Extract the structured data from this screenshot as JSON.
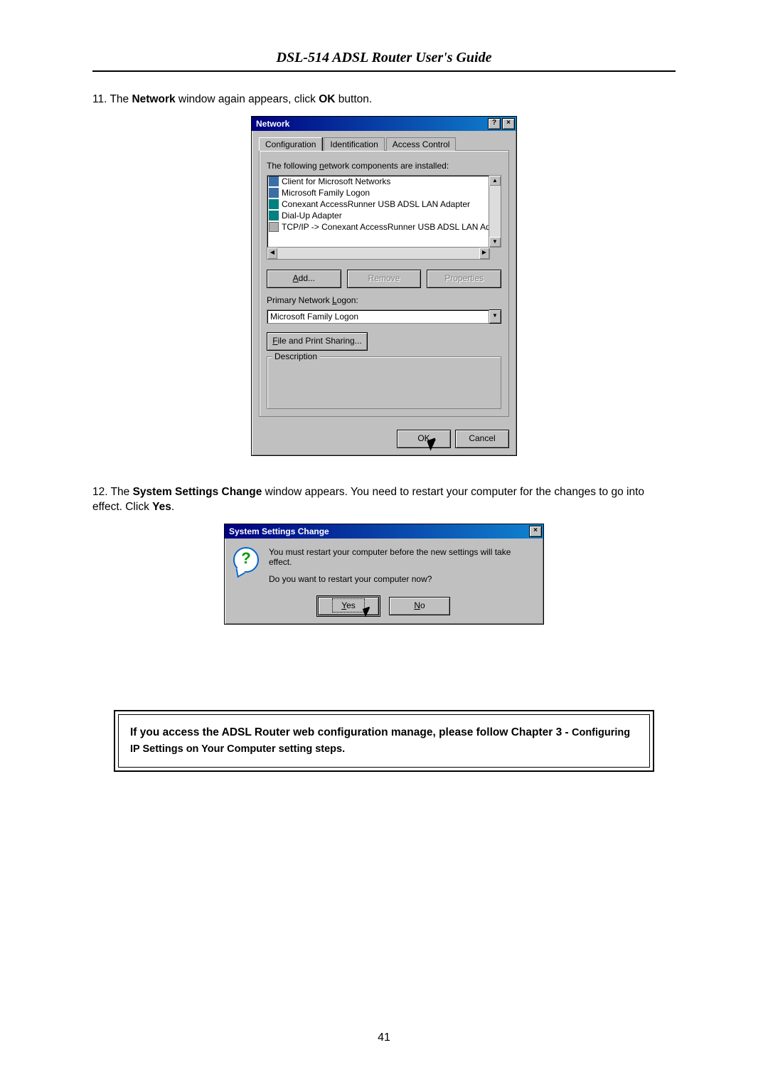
{
  "header": {
    "title": "DSL-514 ADSL Router User's Guide"
  },
  "step11": {
    "num": "11. ",
    "t1": "The ",
    "b1": "Network",
    "t2": " window again appears, click ",
    "b2": "OK",
    "t3": " button."
  },
  "network_dialog": {
    "title": "Network",
    "help_btn": "?",
    "close_btn": "×",
    "tabs": {
      "t1": "Configuration",
      "t2": "Identification",
      "t3": "Access Control"
    },
    "installed_label_pre": "The following ",
    "installed_label_u": "n",
    "installed_label_post": "etwork components are installed:",
    "components": {
      "c0": "Client for Microsoft Networks",
      "c1": "Microsoft Family Logon",
      "c2": "Conexant AccessRunner USB ADSL LAN Adapter",
      "c3": "Dial-Up Adapter",
      "c4": "TCP/IP -> Conexant AccessRunner USB ADSL LAN Ada"
    },
    "scroll": {
      "up": "▲",
      "down": "▼",
      "left": "◀",
      "right": "▶"
    },
    "buttons": {
      "add_pre": "",
      "add_u": "A",
      "add_post": "dd...",
      "remove": "Remove",
      "properties": "Properties"
    },
    "primary_logon_label_pre": "Primary Network ",
    "primary_logon_label_u": "L",
    "primary_logon_label_post": "ogon:",
    "primary_logon_value": "Microsoft Family Logon",
    "combo_arrow": "▼",
    "file_print_pre": "",
    "file_print_u": "F",
    "file_print_post": "ile and Print Sharing...",
    "description_label": "Description",
    "ok": "OK",
    "cancel": "Cancel"
  },
  "step12": {
    "num": "12. ",
    "t1": "The ",
    "b1": "System Settings Change",
    "t2": " window appears. You need to restart your computer for the changes to go into effect. Click ",
    "b2": "Yes",
    "t3": "."
  },
  "ssc_dialog": {
    "title": "System Settings Change",
    "close_btn": "×",
    "line1": "You must restart your computer before the new settings will take effect.",
    "line2": "Do you want to restart your computer now?",
    "yes_u": "Y",
    "yes_post": "es",
    "no_u": "N",
    "no_post": "o",
    "qmark": "?"
  },
  "note": {
    "t1": "If you access the ADSL Router web configuration manage, please follow Chapter 3",
    "t2": " - ",
    "t3": "Configuring IP Settings on Your Computer setting steps."
  },
  "page_number": "41"
}
